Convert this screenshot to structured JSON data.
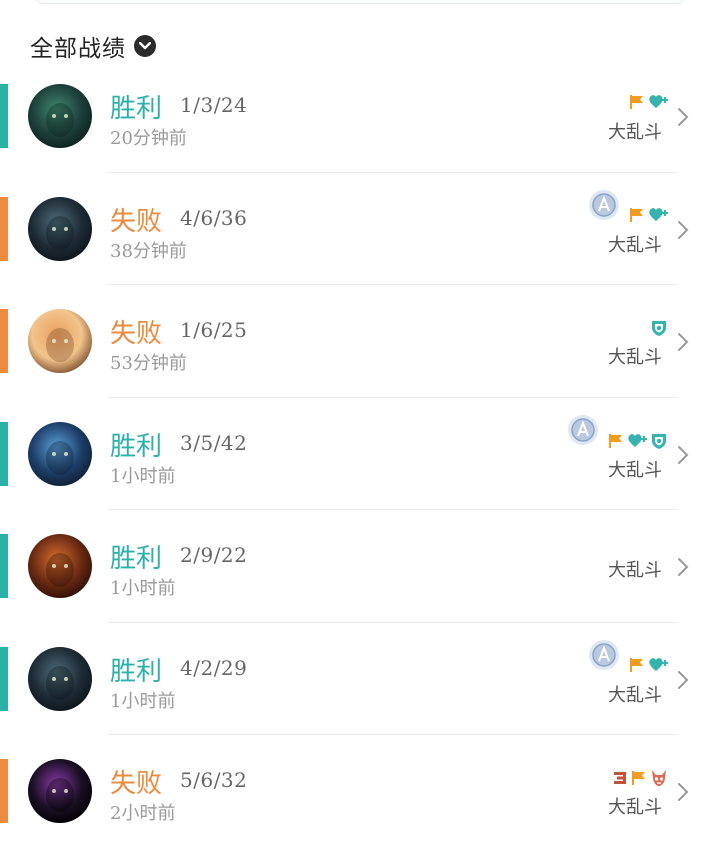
{
  "header": {
    "filter_label": "全部战绩"
  },
  "colors": {
    "win": "#2cb1a8",
    "loss": "#ec8a3d"
  },
  "matches": [
    {
      "result": "胜利",
      "outcome": "win",
      "kda": "1/3/24",
      "time": "20分钟前",
      "mode": "大乱斗",
      "medal": false,
      "tags": [
        "flag-icon",
        "heart-plus-icon"
      ]
    },
    {
      "result": "失败",
      "outcome": "loss",
      "kda": "4/6/36",
      "time": "38分钟前",
      "mode": "大乱斗",
      "medal": true,
      "tags": [
        "flag-icon",
        "heart-plus-icon"
      ]
    },
    {
      "result": "失败",
      "outcome": "loss",
      "kda": "1/6/25",
      "time": "53分钟前",
      "mode": "大乱斗",
      "medal": false,
      "tags": [
        "shield-icon"
      ]
    },
    {
      "result": "胜利",
      "outcome": "win",
      "kda": "3/5/42",
      "time": "1小时前",
      "mode": "大乱斗",
      "medal": true,
      "tags": [
        "flag-icon",
        "heart-plus-icon",
        "shield-icon"
      ]
    },
    {
      "result": "胜利",
      "outcome": "win",
      "kda": "2/9/22",
      "time": "1小时前",
      "mode": "大乱斗",
      "medal": false,
      "tags": []
    },
    {
      "result": "胜利",
      "outcome": "win",
      "kda": "4/2/29",
      "time": "1小时前",
      "mode": "大乱斗",
      "medal": true,
      "tags": [
        "flag-icon",
        "heart-plus-icon"
      ]
    },
    {
      "result": "失败",
      "outcome": "loss",
      "kda": "5/6/32",
      "time": "2小时前",
      "mode": "大乱斗",
      "medal": false,
      "tags": [
        "triple-kill-icon",
        "flag-icon",
        "demon-icon"
      ]
    }
  ]
}
